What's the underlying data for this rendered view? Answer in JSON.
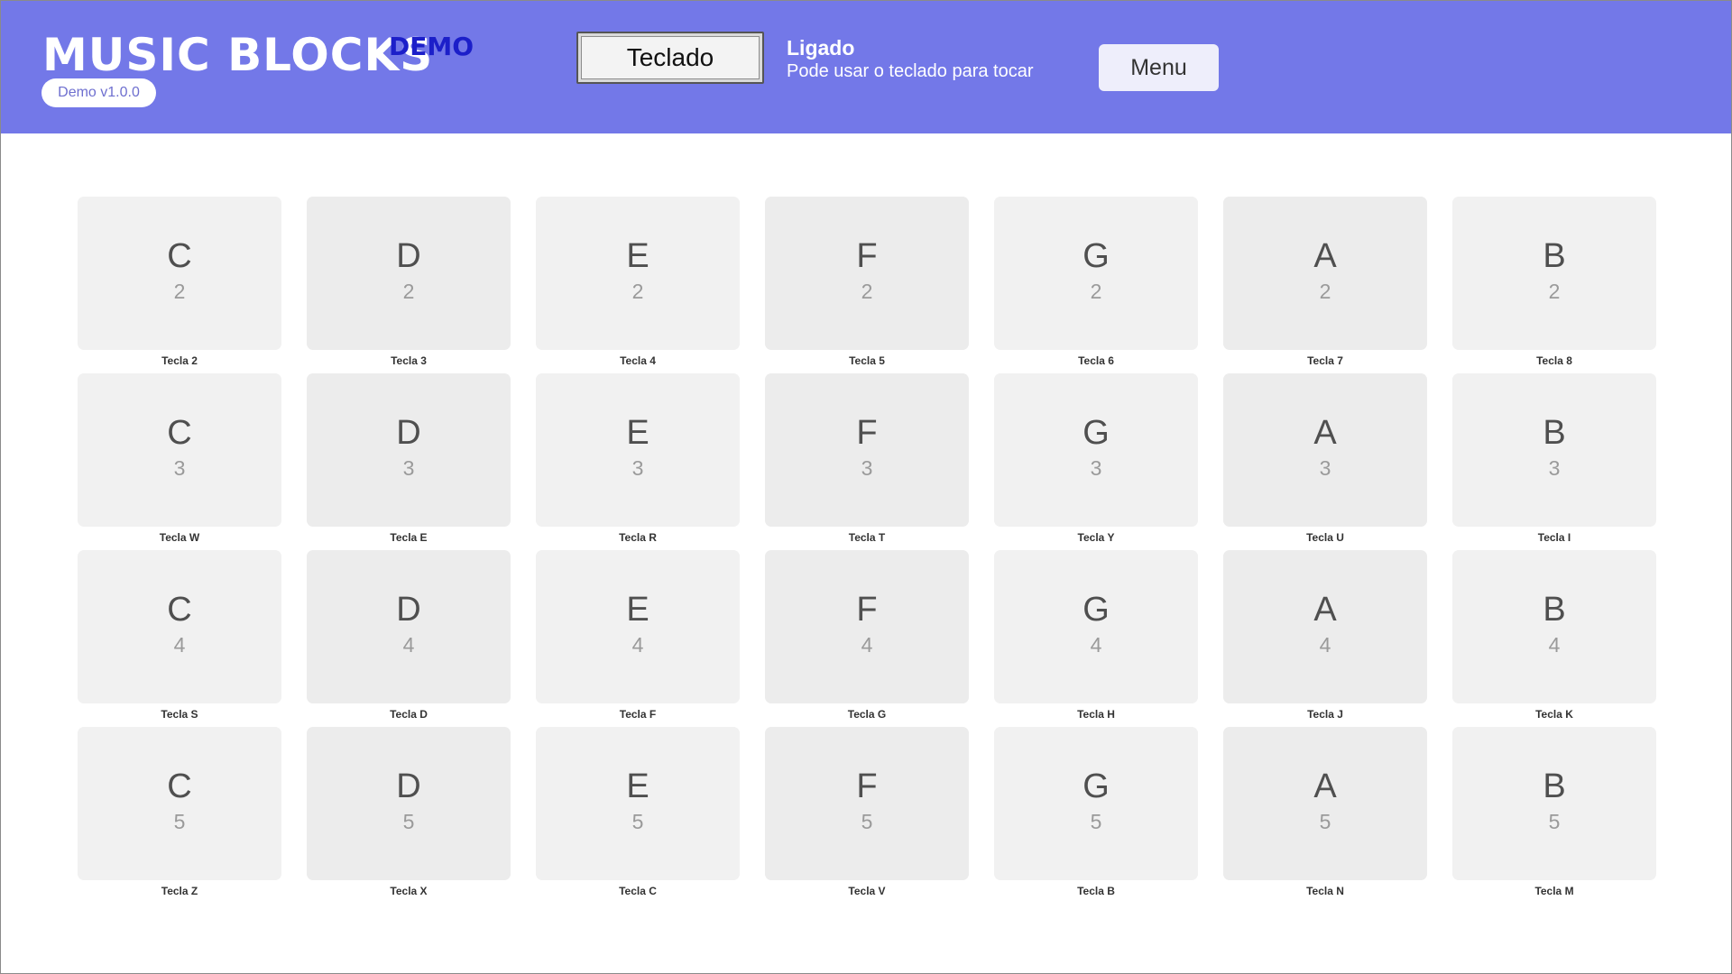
{
  "header": {
    "logo": "MUSIC BLOCKS",
    "logo_tag": "DEMO",
    "version": "Demo v1.0.0",
    "keyboard_button": "Teclado",
    "status_title": "Ligado",
    "status_subtitle": "Pode usar o teclado para tocar",
    "menu_button": "Menu"
  },
  "colors": {
    "header_bg": "#7378e8",
    "logo_tag": "#1c1fc9",
    "key_bg": "#f1f1f1",
    "key_bg_alt": "#ececec"
  },
  "keys": [
    {
      "note": "C",
      "octave": "2",
      "label": "Tecla 2"
    },
    {
      "note": "D",
      "octave": "2",
      "label": "Tecla 3"
    },
    {
      "note": "E",
      "octave": "2",
      "label": "Tecla 4"
    },
    {
      "note": "F",
      "octave": "2",
      "label": "Tecla 5"
    },
    {
      "note": "G",
      "octave": "2",
      "label": "Tecla 6"
    },
    {
      "note": "A",
      "octave": "2",
      "label": "Tecla 7"
    },
    {
      "note": "B",
      "octave": "2",
      "label": "Tecla 8"
    },
    {
      "note": "C",
      "octave": "3",
      "label": "Tecla W"
    },
    {
      "note": "D",
      "octave": "3",
      "label": "Tecla E"
    },
    {
      "note": "E",
      "octave": "3",
      "label": "Tecla R"
    },
    {
      "note": "F",
      "octave": "3",
      "label": "Tecla T"
    },
    {
      "note": "G",
      "octave": "3",
      "label": "Tecla Y"
    },
    {
      "note": "A",
      "octave": "3",
      "label": "Tecla U"
    },
    {
      "note": "B",
      "octave": "3",
      "label": "Tecla I"
    },
    {
      "note": "C",
      "octave": "4",
      "label": "Tecla S"
    },
    {
      "note": "D",
      "octave": "4",
      "label": "Tecla D"
    },
    {
      "note": "E",
      "octave": "4",
      "label": "Tecla F"
    },
    {
      "note": "F",
      "octave": "4",
      "label": "Tecla G"
    },
    {
      "note": "G",
      "octave": "4",
      "label": "Tecla H"
    },
    {
      "note": "A",
      "octave": "4",
      "label": "Tecla J"
    },
    {
      "note": "B",
      "octave": "4",
      "label": "Tecla K"
    },
    {
      "note": "C",
      "octave": "5",
      "label": "Tecla Z"
    },
    {
      "note": "D",
      "octave": "5",
      "label": "Tecla X"
    },
    {
      "note": "E",
      "octave": "5",
      "label": "Tecla C"
    },
    {
      "note": "F",
      "octave": "5",
      "label": "Tecla V"
    },
    {
      "note": "G",
      "octave": "5",
      "label": "Tecla B"
    },
    {
      "note": "A",
      "octave": "5",
      "label": "Tecla N"
    },
    {
      "note": "B",
      "octave": "5",
      "label": "Tecla M"
    }
  ]
}
